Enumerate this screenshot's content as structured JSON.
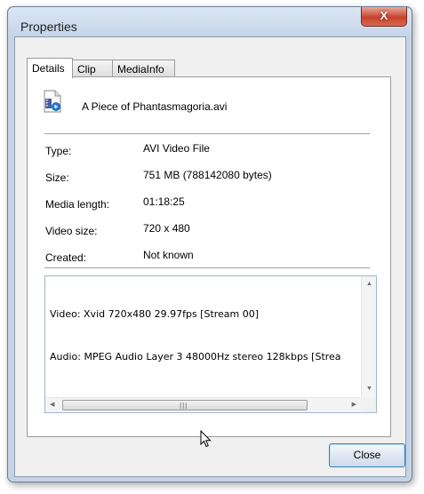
{
  "window": {
    "title": "Properties",
    "close_glyph": "X"
  },
  "tabs": [
    {
      "label": "Details",
      "active": true
    },
    {
      "label": "Clip",
      "active": false
    },
    {
      "label": "MediaInfo",
      "active": false
    }
  ],
  "file": {
    "icon": "video-file-icon",
    "name": "A Piece of Phantasmagoria.avi"
  },
  "properties": [
    {
      "label": "Type:",
      "value": "AVI Video File"
    },
    {
      "label": "Size:",
      "value": "751 MB (788142080 bytes)"
    },
    {
      "label": "Media length:",
      "value": "01:18:25"
    },
    {
      "label": "Video size:",
      "value": "720 x 480"
    },
    {
      "label": "Created:",
      "value": "Not known"
    }
  ],
  "streams": {
    "lines": [
      "Video: Xvid 720x480 29.97fps [Stream 00]",
      "Audio: MPEG Audio Layer 3 48000Hz stereo 128kbps [Strea"
    ]
  },
  "footer": {
    "close_label": "Close"
  },
  "colors": {
    "accent": "#3c7fb1",
    "close_red": "#c7432b"
  }
}
